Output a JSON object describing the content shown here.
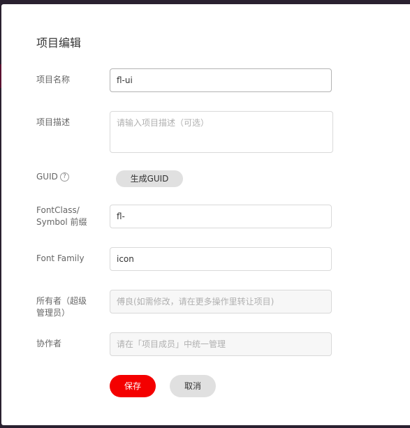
{
  "dialog": {
    "title": "项目编辑"
  },
  "form": {
    "name": {
      "label": "项目名称",
      "value": "fl-ui"
    },
    "description": {
      "label": "项目描述",
      "placeholder": "请输入项目描述（可选）"
    },
    "guid": {
      "label": "GUID",
      "help_symbol": "?",
      "button_label": "生成GUID"
    },
    "font_class": {
      "label_line1": "FontClass/",
      "label_line2": "Symbol 前缀",
      "value": "fl-"
    },
    "font_family": {
      "label": "Font Family",
      "value": "icon"
    },
    "owner": {
      "label_line1": "所有者（超级",
      "label_line2": "管理员）",
      "value": "傅良(如需修改，请在更多操作里转让项目)"
    },
    "collaborators": {
      "label": "协作者",
      "value": "请在「项目成员」中统一管理"
    }
  },
  "actions": {
    "save_label": "保存",
    "cancel_label": "取消"
  },
  "colors": {
    "primary": "#f40000",
    "secondary_button": "#e0e0e0",
    "backdrop": "#2a2130"
  }
}
